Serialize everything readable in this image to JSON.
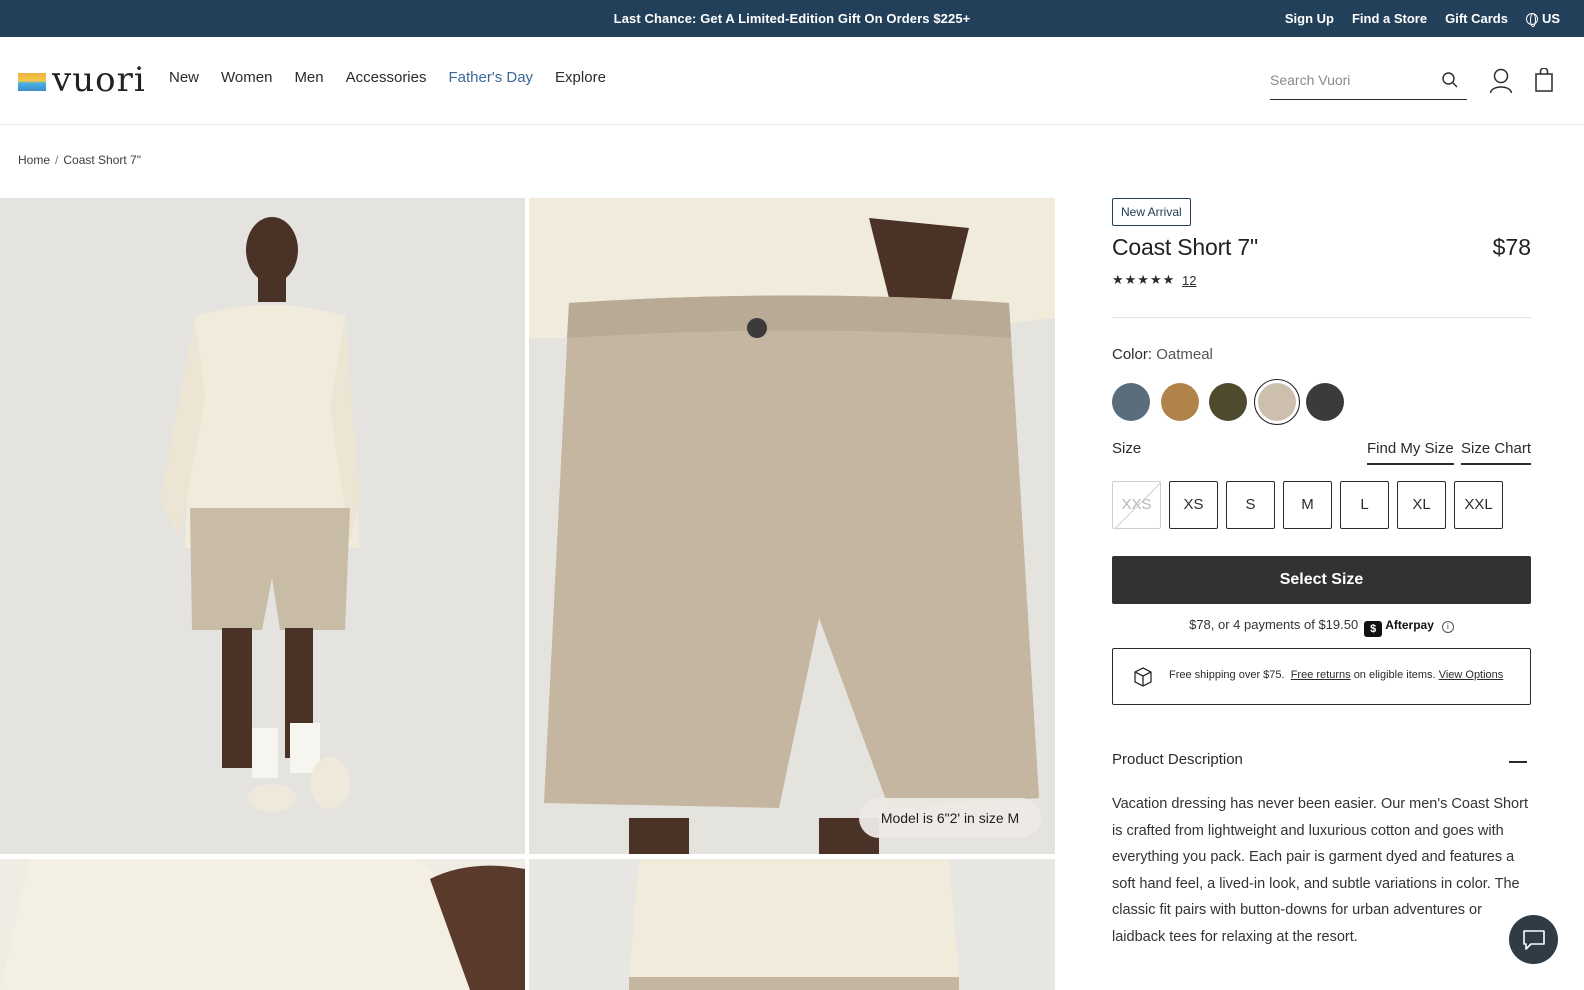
{
  "announcement": {
    "message": "Last Chance: Get A Limited-Edition Gift On Orders $225+",
    "links": [
      "Sign Up",
      "Find a Store",
      "Gift Cards"
    ],
    "region": "US"
  },
  "header": {
    "logo": "vuori",
    "nav": [
      "New",
      "Women",
      "Men",
      "Accessories",
      "Father's Day",
      "Explore"
    ],
    "search_placeholder": "Search Vuori"
  },
  "breadcrumb": {
    "home": "Home",
    "current": "Coast Short 7\""
  },
  "gallery": {
    "model_note": "Model is 6\"2' in size M"
  },
  "product": {
    "tag": "New Arrival",
    "title": "Coast Short 7\"",
    "price": "$78",
    "rating_stars": "★★★★★",
    "review_count": "12",
    "color_label": "Color:",
    "color_value": "Oatmeal",
    "swatches": [
      {
        "name": "slate-blue",
        "color": "#5a6d7c"
      },
      {
        "name": "camel",
        "color": "#b0834a"
      },
      {
        "name": "olive",
        "color": "#4e4a2e"
      },
      {
        "name": "oatmeal",
        "color": "#cdbfae"
      },
      {
        "name": "charcoal",
        "color": "#3b3b3b"
      }
    ],
    "size_label": "Size",
    "find_my_size": "Find My Size",
    "size_chart": "Size Chart",
    "sizes": [
      "XXS",
      "XS",
      "S",
      "M",
      "L",
      "XL",
      "XXL"
    ],
    "unavailable_sizes": [
      "XXS"
    ],
    "cta": "Select Size",
    "afterpay_text": "$78, or 4 payments of $19.50",
    "afterpay_brand": "Afterpay",
    "shipping": {
      "text1": "Free shipping over $75.",
      "link1": "Free returns",
      "text2": "on eligible items.",
      "link2": "View Options"
    },
    "description_heading": "Product Description",
    "description": "Vacation dressing has never been easier. Our men's Coast Short is crafted from lightweight and luxurious cotton and goes with everything you pack. Each pair is garment dyed and features a soft hand feel, a lived-in look, and subtle variations in color. The classic fit pairs with button-downs for urban adventures or laidback tees for relaxing at the resort."
  },
  "colors": {
    "announcement_bg": "#23405a",
    "accent_nav": "#3d6796",
    "cta_bg": "#323232"
  }
}
